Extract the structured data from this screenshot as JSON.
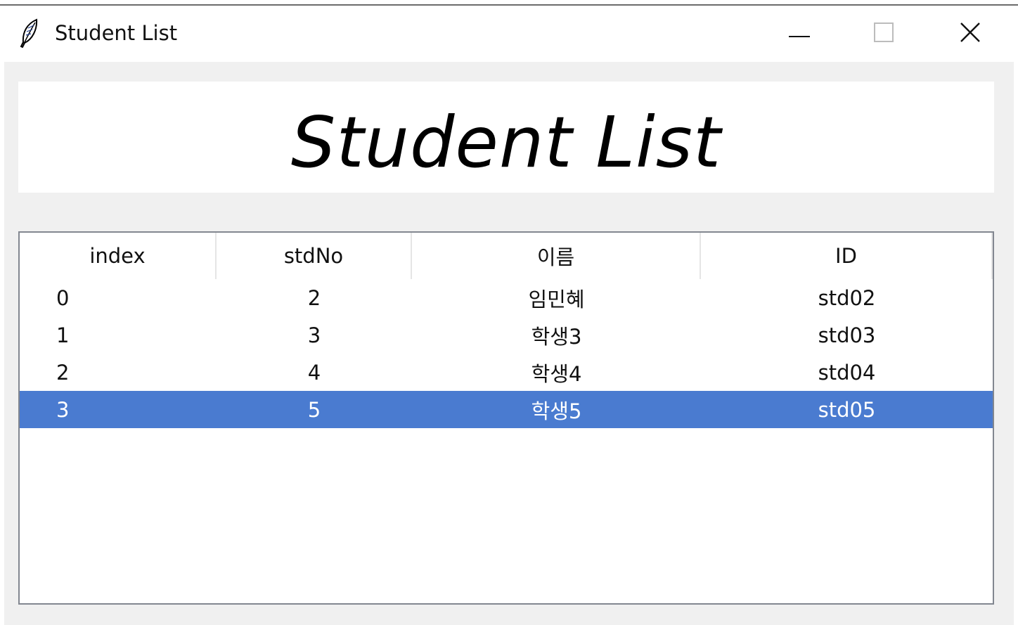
{
  "window": {
    "title": "Student List",
    "icon": "feather-icon",
    "controls": [
      "minimize-icon",
      "maximize-icon",
      "close-icon"
    ]
  },
  "header": {
    "title": "Student List"
  },
  "table": {
    "columns": [
      "index",
      "stdNo",
      "이름",
      "ID"
    ],
    "rows": [
      [
        "0",
        "2",
        "임민혜",
        "std02"
      ],
      [
        "1",
        "3",
        "학생3",
        "std03"
      ],
      [
        "2",
        "4",
        "학생4",
        "std04"
      ],
      [
        "3",
        "5",
        "학생5",
        "std05"
      ]
    ],
    "selected_row": 3
  },
  "colors": {
    "selection": "#4a7bd0",
    "client_background": "#f0f0f0",
    "table_border": "#828790"
  }
}
